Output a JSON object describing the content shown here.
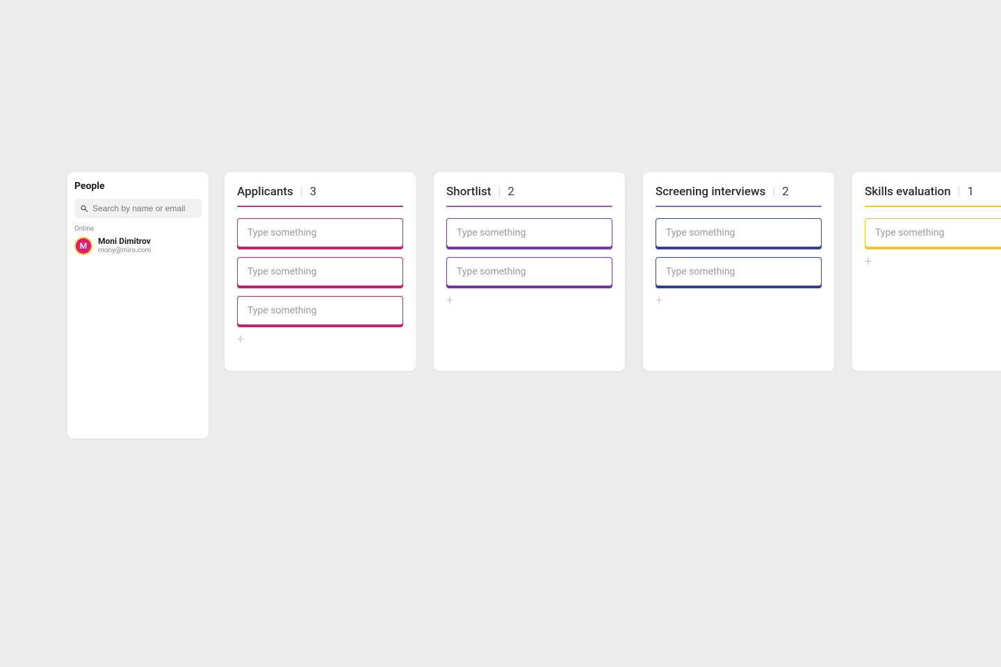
{
  "people_panel": {
    "title": "People",
    "search_placeholder": "Search by name or email",
    "online_label": "Online",
    "users": [
      {
        "initial": "M",
        "name": "Moni Dimitrov",
        "email": "mony@miro.com"
      }
    ]
  },
  "board": {
    "card_placeholder": "Type something",
    "add_label": "+",
    "columns": [
      {
        "id": "applicants",
        "title": "Applicants",
        "count": "3",
        "underline_color": "#b33a7a",
        "card_border": "#d11a6b",
        "card_shadow": "#d11a6b",
        "cards": 3
      },
      {
        "id": "shortlist",
        "title": "Shortlist",
        "count": "2",
        "underline_color": "#9a5aa8",
        "card_border": "#6a3fb5",
        "card_shadow": "#7a2fb0",
        "cards": 2
      },
      {
        "id": "screening",
        "title": "Screening interviews",
        "count": "2",
        "underline_color": "#6a76b4",
        "card_border": "#2f3fa0",
        "card_shadow": "#2f3fa0",
        "cards": 2
      },
      {
        "id": "skills",
        "title": "Skills evaluation",
        "count": "1",
        "underline_color": "#f4c430",
        "card_border": "#f4c430",
        "card_shadow": "#f4c430",
        "cards": 1
      }
    ]
  }
}
